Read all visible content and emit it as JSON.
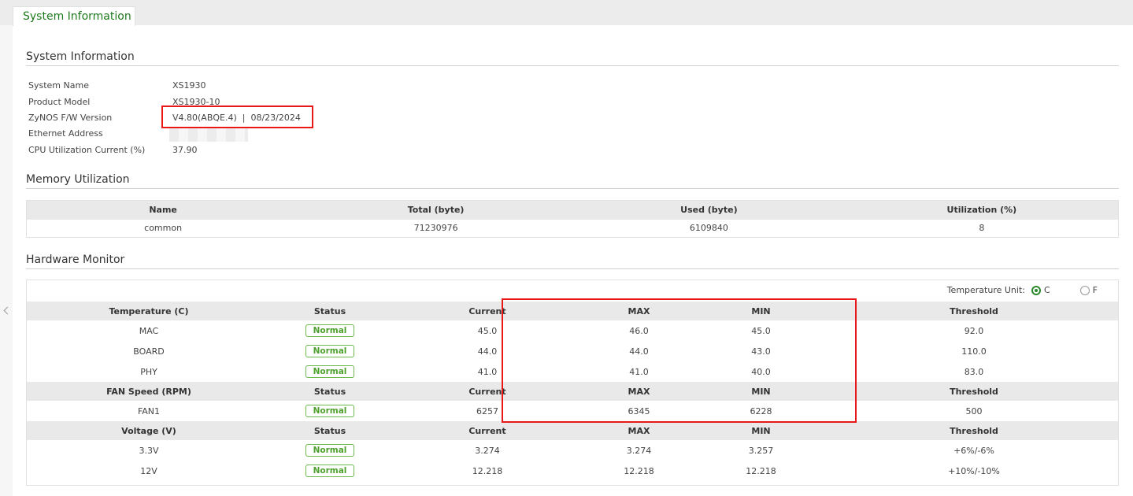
{
  "tab": {
    "label": "System Information"
  },
  "system_info": {
    "title": "System Information",
    "rows": [
      {
        "label": "System Name",
        "value": "XS1930"
      },
      {
        "label": "Product Model",
        "value": "XS1930-10"
      },
      {
        "label": "ZyNOS F/W Version",
        "value": "V4.80(ABQE.4)  |  08/23/2024"
      },
      {
        "label": "Ethernet Address",
        "value": ""
      },
      {
        "label": "CPU Utilization Current (%)",
        "value": "37.90"
      }
    ]
  },
  "memory": {
    "title": "Memory Utilization",
    "headers": [
      "Name",
      "Total (byte)",
      "Used (byte)",
      "Utilization (%)"
    ],
    "row": [
      "common",
      "71230976",
      "6109840",
      "8"
    ]
  },
  "hardware": {
    "title": "Hardware Monitor",
    "unit_label": "Temperature Unit:",
    "unit_c": "C",
    "unit_f": "F",
    "temperature": {
      "headers": [
        "Temperature (C)",
        "Status",
        "Current",
        "MAX",
        "MIN",
        "Threshold"
      ],
      "rows": [
        [
          "MAC",
          "Normal",
          "45.0",
          "46.0",
          "45.0",
          "92.0"
        ],
        [
          "BOARD",
          "Normal",
          "44.0",
          "44.0",
          "43.0",
          "110.0"
        ],
        [
          "PHY",
          "Normal",
          "41.0",
          "41.0",
          "40.0",
          "83.0"
        ]
      ]
    },
    "fan": {
      "headers": [
        "FAN Speed (RPM)",
        "Status",
        "Current",
        "MAX",
        "MIN",
        "Threshold"
      ],
      "rows": [
        [
          "FAN1",
          "Normal",
          "6257",
          "6345",
          "6228",
          "500"
        ]
      ]
    },
    "voltage": {
      "headers": [
        "Voltage (V)",
        "Status",
        "Current",
        "MAX",
        "MIN",
        "Threshold"
      ],
      "rows": [
        [
          "3.3V",
          "Normal",
          "3.274",
          "3.274",
          "3.257",
          "+6%/-6%"
        ],
        [
          "12V",
          "Normal",
          "12.218",
          "12.218",
          "12.218",
          "+10%/-10%"
        ]
      ]
    }
  },
  "colors": {
    "accent_green": "#2a8a2a",
    "highlight_red": "#e81818",
    "status_green": "#4fa12d"
  }
}
